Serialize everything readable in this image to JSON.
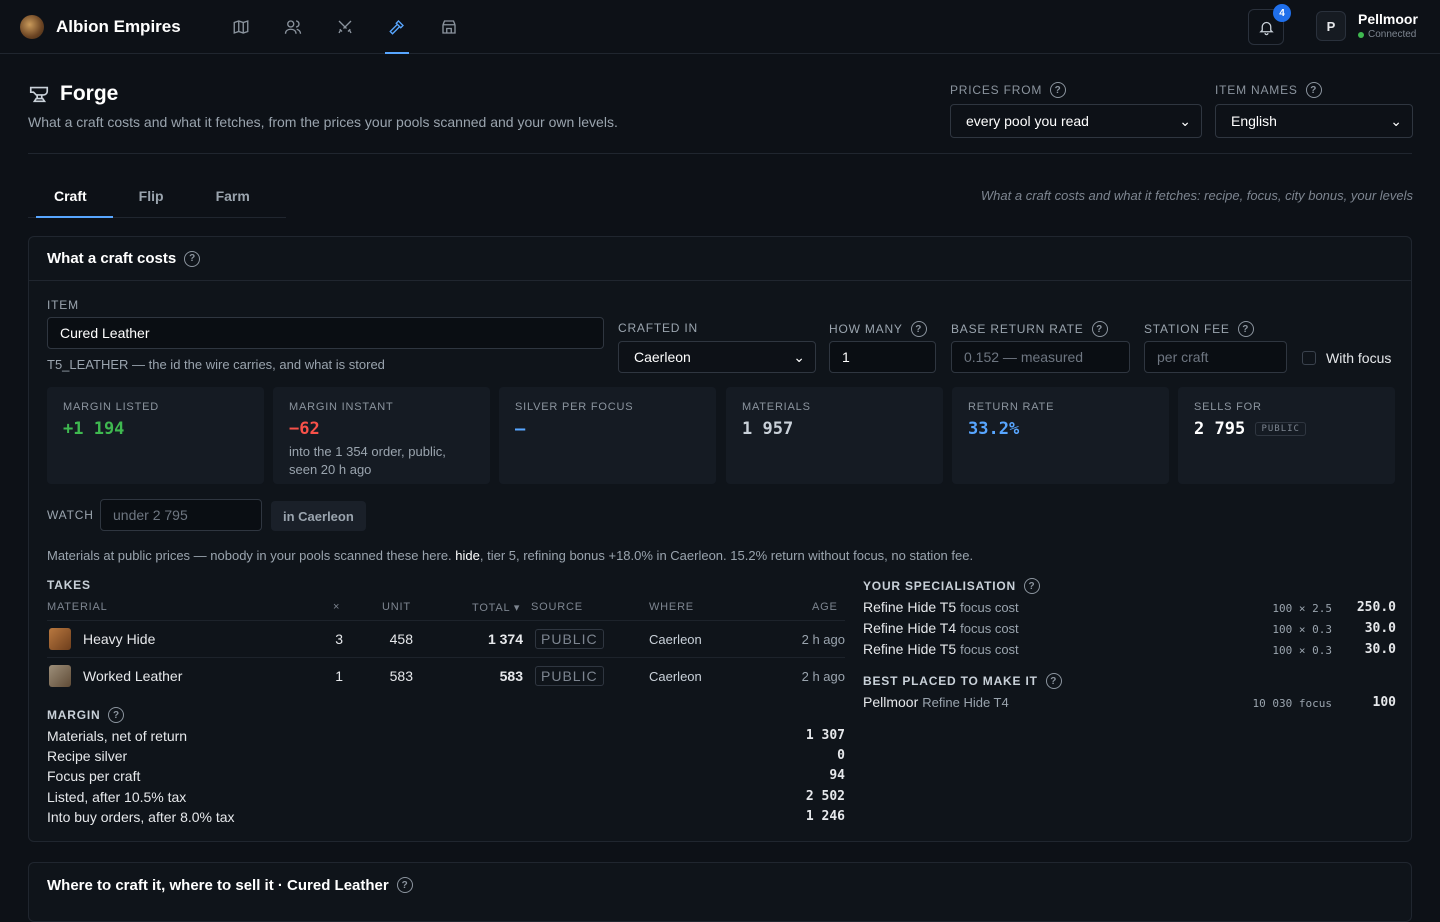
{
  "app": {
    "name": "Albion Empires"
  },
  "nav": {
    "icons": [
      "map-icon",
      "users-icon",
      "swords-icon",
      "hammer-icon",
      "store-icon"
    ],
    "active": "hammer-icon"
  },
  "notifications": {
    "count": "4"
  },
  "user": {
    "initial": "P",
    "name": "Pellmoor",
    "status": "Connected"
  },
  "page": {
    "title": "Forge",
    "subtitle": "What a craft costs and what it fetches, from the prices your pools scanned and your own levels."
  },
  "prices_from": {
    "label": "PRICES FROM",
    "value": "every pool you read"
  },
  "item_names": {
    "label": "ITEM NAMES",
    "value": "English"
  },
  "tabs": [
    {
      "label": "Craft",
      "active": true
    },
    {
      "label": "Flip"
    },
    {
      "label": "Farm"
    }
  ],
  "tab_hint": "What a craft costs and what it fetches: recipe, focus, city bonus, your levels",
  "craft": {
    "title": "What a craft costs",
    "item_label": "ITEM",
    "item_value": "Cured Leather",
    "item_hint": "T5_LEATHER — the id the wire carries, and what is stored",
    "crafted_in_label": "CRAFTED IN",
    "crafted_in_value": "Caerleon",
    "how_many_label": "HOW MANY",
    "how_many_value": "1",
    "base_return_label": "BASE RETURN RATE",
    "base_return_placeholder": "0.152 — measured",
    "station_fee_label": "STATION FEE",
    "station_fee_placeholder": "per craft",
    "with_focus_label": "With focus",
    "stats": [
      {
        "key": "MARGIN LISTED",
        "value": "+1 194"
      },
      {
        "key": "MARGIN INSTANT",
        "value": "−62",
        "desc": "into the 1 354 order, public, seen 20 h ago"
      },
      {
        "key": "SILVER PER FOCUS",
        "value": "–"
      },
      {
        "key": "MATERIALS",
        "value": "1 957"
      },
      {
        "key": "RETURN RATE",
        "value": "33.2%"
      },
      {
        "key": "SELLS FOR",
        "value": "2 795",
        "tag": "PUBLIC"
      }
    ],
    "watch_label": "WATCH",
    "watch_placeholder": "under 2 795",
    "watch_button": "in Caerleon",
    "note_prefix": "Materials at public prices — nobody in your pools scanned these here. ",
    "note_link": "hide",
    "note_suffix": ", tier 5, refining bonus +18.0% in Caerleon. 15.2% return without focus, no station fee.",
    "takes_label": "TAKES",
    "columns": [
      "MATERIAL",
      "×",
      "UNIT",
      "TOTAL ▾",
      "SOURCE",
      "WHERE",
      "AGE"
    ],
    "rows": [
      {
        "name": "Heavy Hide",
        "qty": "3",
        "unit": "458",
        "total": "1 374",
        "source": "PUBLIC",
        "where": "Caerleon",
        "age": "2 h ago"
      },
      {
        "name": "Worked Leather",
        "qty": "1",
        "unit": "583",
        "total": "583",
        "source": "PUBLIC",
        "where": "Caerleon",
        "age": "2 h ago"
      }
    ],
    "margin_label": "MARGIN",
    "margin": [
      {
        "label": "Materials, net of return",
        "value": "1 307"
      },
      {
        "label": "Recipe silver",
        "value": "0"
      },
      {
        "label": "Focus per craft",
        "value": "94"
      },
      {
        "label": "Listed, after 10.5% tax",
        "value": "2 502"
      },
      {
        "label": "Into buy orders, after 8.0% tax",
        "value": "1 246"
      }
    ],
    "spec_label": "YOUR SPECIALISATION",
    "spec": [
      {
        "name": "Refine Hide T5",
        "sub": "focus cost",
        "mult": "100 × 2.5",
        "value": "250.0"
      },
      {
        "name": "Refine Hide T4",
        "sub": "focus cost",
        "mult": "100 × 0.3",
        "value": "30.0"
      },
      {
        "name": "Refine Hide T5",
        "sub": "focus cost",
        "mult": "100 × 0.3",
        "value": "30.0"
      }
    ],
    "best_label": "BEST PLACED TO MAKE IT",
    "best": {
      "name": "Pellmoor",
      "sub": "Refine Hide T4",
      "focus": "10 030 focus",
      "value": "100"
    }
  },
  "where_card": {
    "title": "Where to craft it, where to sell it · Cured Leather"
  }
}
